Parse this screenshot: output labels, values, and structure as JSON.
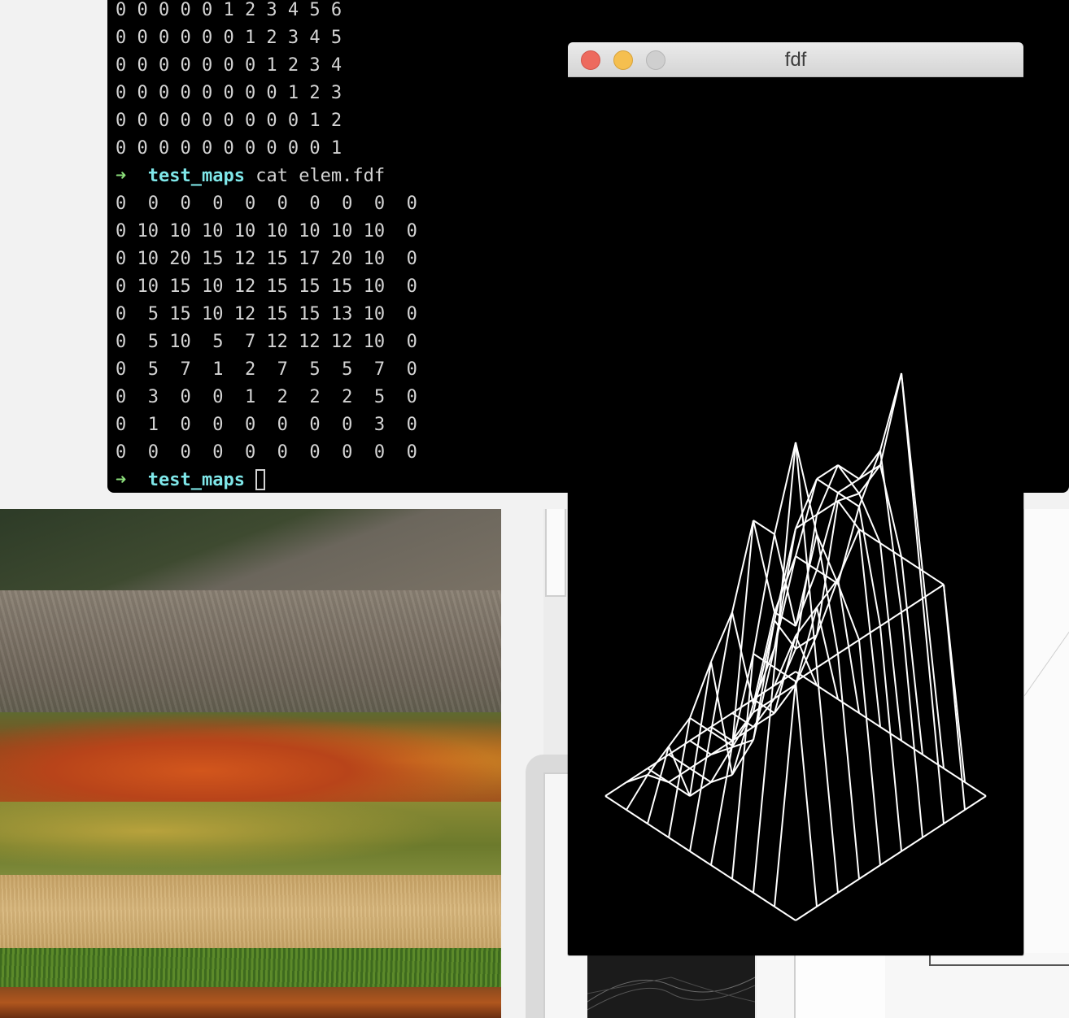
{
  "terminal": {
    "lines": [
      {
        "type": "output",
        "text": "0 0 0 0 0 1 2 3 4 5 6"
      },
      {
        "type": "output",
        "text": "0 0 0 0 0 0 1 2 3 4 5"
      },
      {
        "type": "output",
        "text": "0 0 0 0 0 0 0 1 2 3 4"
      },
      {
        "type": "output",
        "text": "0 0 0 0 0 0 0 0 1 2 3"
      },
      {
        "type": "output",
        "text": "0 0 0 0 0 0 0 0 0 1 2"
      },
      {
        "type": "output",
        "text": "0 0 0 0 0 0 0 0 0 0 1"
      },
      {
        "type": "prompt",
        "arrow": "➜",
        "dir": "test_maps",
        "cmd": " cat elem.fdf"
      },
      {
        "type": "output",
        "text": "0  0  0  0  0  0  0  0  0  0"
      },
      {
        "type": "output",
        "text": "0 10 10 10 10 10 10 10 10  0"
      },
      {
        "type": "output",
        "text": "0 10 20 15 12 15 17 20 10  0"
      },
      {
        "type": "output",
        "text": "0 10 15 10 12 15 15 15 10  0"
      },
      {
        "type": "output",
        "text": "0  5 15 10 12 15 15 13 10  0"
      },
      {
        "type": "output",
        "text": "0  5 10  5  7 12 12 12 10  0"
      },
      {
        "type": "output",
        "text": "0  5  7  1  2  7  5  5  7  0"
      },
      {
        "type": "output",
        "text": "0  3  0  0  1  2  2  2  5  0"
      },
      {
        "type": "output",
        "text": "0  1  0  0  0  0  0  0  3  0"
      },
      {
        "type": "output",
        "text": "0  0  0  0  0  0  0  0  0  0"
      },
      {
        "type": "prompt",
        "arrow": "➜",
        "dir": "test_maps",
        "cmd": " ",
        "cursor": true
      }
    ]
  },
  "fdf_window": {
    "title": "fdf",
    "buttons": [
      "close",
      "minimize",
      "zoom"
    ]
  },
  "colors": {
    "terminal_bg": "#000000",
    "prompt_arrow": "#8de07c",
    "prompt_dir": "#7fe7e9",
    "wireframe": "#ffffff"
  }
}
